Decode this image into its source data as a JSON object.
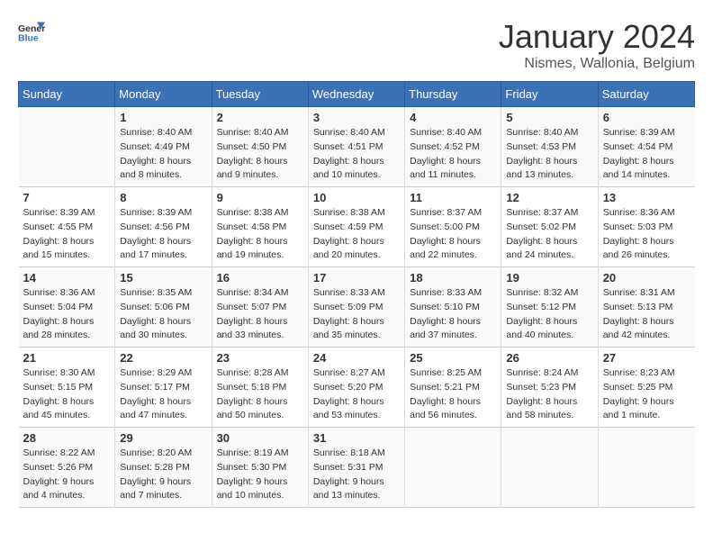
{
  "logo": {
    "line1": "General",
    "line2": "Blue"
  },
  "title": "January 2024",
  "subtitle": "Nismes, Wallonia, Belgium",
  "weekdays": [
    "Sunday",
    "Monday",
    "Tuesday",
    "Wednesday",
    "Thursday",
    "Friday",
    "Saturday"
  ],
  "weeks": [
    [
      {
        "day": "",
        "sunrise": "",
        "sunset": "",
        "daylight": ""
      },
      {
        "day": "1",
        "sunrise": "Sunrise: 8:40 AM",
        "sunset": "Sunset: 4:49 PM",
        "daylight": "Daylight: 8 hours and 8 minutes."
      },
      {
        "day": "2",
        "sunrise": "Sunrise: 8:40 AM",
        "sunset": "Sunset: 4:50 PM",
        "daylight": "Daylight: 8 hours and 9 minutes."
      },
      {
        "day": "3",
        "sunrise": "Sunrise: 8:40 AM",
        "sunset": "Sunset: 4:51 PM",
        "daylight": "Daylight: 8 hours and 10 minutes."
      },
      {
        "day": "4",
        "sunrise": "Sunrise: 8:40 AM",
        "sunset": "Sunset: 4:52 PM",
        "daylight": "Daylight: 8 hours and 11 minutes."
      },
      {
        "day": "5",
        "sunrise": "Sunrise: 8:40 AM",
        "sunset": "Sunset: 4:53 PM",
        "daylight": "Daylight: 8 hours and 13 minutes."
      },
      {
        "day": "6",
        "sunrise": "Sunrise: 8:39 AM",
        "sunset": "Sunset: 4:54 PM",
        "daylight": "Daylight: 8 hours and 14 minutes."
      }
    ],
    [
      {
        "day": "7",
        "sunrise": "Sunrise: 8:39 AM",
        "sunset": "Sunset: 4:55 PM",
        "daylight": "Daylight: 8 hours and 15 minutes."
      },
      {
        "day": "8",
        "sunrise": "Sunrise: 8:39 AM",
        "sunset": "Sunset: 4:56 PM",
        "daylight": "Daylight: 8 hours and 17 minutes."
      },
      {
        "day": "9",
        "sunrise": "Sunrise: 8:38 AM",
        "sunset": "Sunset: 4:58 PM",
        "daylight": "Daylight: 8 hours and 19 minutes."
      },
      {
        "day": "10",
        "sunrise": "Sunrise: 8:38 AM",
        "sunset": "Sunset: 4:59 PM",
        "daylight": "Daylight: 8 hours and 20 minutes."
      },
      {
        "day": "11",
        "sunrise": "Sunrise: 8:37 AM",
        "sunset": "Sunset: 5:00 PM",
        "daylight": "Daylight: 8 hours and 22 minutes."
      },
      {
        "day": "12",
        "sunrise": "Sunrise: 8:37 AM",
        "sunset": "Sunset: 5:02 PM",
        "daylight": "Daylight: 8 hours and 24 minutes."
      },
      {
        "day": "13",
        "sunrise": "Sunrise: 8:36 AM",
        "sunset": "Sunset: 5:03 PM",
        "daylight": "Daylight: 8 hours and 26 minutes."
      }
    ],
    [
      {
        "day": "14",
        "sunrise": "Sunrise: 8:36 AM",
        "sunset": "Sunset: 5:04 PM",
        "daylight": "Daylight: 8 hours and 28 minutes."
      },
      {
        "day": "15",
        "sunrise": "Sunrise: 8:35 AM",
        "sunset": "Sunset: 5:06 PM",
        "daylight": "Daylight: 8 hours and 30 minutes."
      },
      {
        "day": "16",
        "sunrise": "Sunrise: 8:34 AM",
        "sunset": "Sunset: 5:07 PM",
        "daylight": "Daylight: 8 hours and 33 minutes."
      },
      {
        "day": "17",
        "sunrise": "Sunrise: 8:33 AM",
        "sunset": "Sunset: 5:09 PM",
        "daylight": "Daylight: 8 hours and 35 minutes."
      },
      {
        "day": "18",
        "sunrise": "Sunrise: 8:33 AM",
        "sunset": "Sunset: 5:10 PM",
        "daylight": "Daylight: 8 hours and 37 minutes."
      },
      {
        "day": "19",
        "sunrise": "Sunrise: 8:32 AM",
        "sunset": "Sunset: 5:12 PM",
        "daylight": "Daylight: 8 hours and 40 minutes."
      },
      {
        "day": "20",
        "sunrise": "Sunrise: 8:31 AM",
        "sunset": "Sunset: 5:13 PM",
        "daylight": "Daylight: 8 hours and 42 minutes."
      }
    ],
    [
      {
        "day": "21",
        "sunrise": "Sunrise: 8:30 AM",
        "sunset": "Sunset: 5:15 PM",
        "daylight": "Daylight: 8 hours and 45 minutes."
      },
      {
        "day": "22",
        "sunrise": "Sunrise: 8:29 AM",
        "sunset": "Sunset: 5:17 PM",
        "daylight": "Daylight: 8 hours and 47 minutes."
      },
      {
        "day": "23",
        "sunrise": "Sunrise: 8:28 AM",
        "sunset": "Sunset: 5:18 PM",
        "daylight": "Daylight: 8 hours and 50 minutes."
      },
      {
        "day": "24",
        "sunrise": "Sunrise: 8:27 AM",
        "sunset": "Sunset: 5:20 PM",
        "daylight": "Daylight: 8 hours and 53 minutes."
      },
      {
        "day": "25",
        "sunrise": "Sunrise: 8:25 AM",
        "sunset": "Sunset: 5:21 PM",
        "daylight": "Daylight: 8 hours and 56 minutes."
      },
      {
        "day": "26",
        "sunrise": "Sunrise: 8:24 AM",
        "sunset": "Sunset: 5:23 PM",
        "daylight": "Daylight: 8 hours and 58 minutes."
      },
      {
        "day": "27",
        "sunrise": "Sunrise: 8:23 AM",
        "sunset": "Sunset: 5:25 PM",
        "daylight": "Daylight: 9 hours and 1 minute."
      }
    ],
    [
      {
        "day": "28",
        "sunrise": "Sunrise: 8:22 AM",
        "sunset": "Sunset: 5:26 PM",
        "daylight": "Daylight: 9 hours and 4 minutes."
      },
      {
        "day": "29",
        "sunrise": "Sunrise: 8:20 AM",
        "sunset": "Sunset: 5:28 PM",
        "daylight": "Daylight: 9 hours and 7 minutes."
      },
      {
        "day": "30",
        "sunrise": "Sunrise: 8:19 AM",
        "sunset": "Sunset: 5:30 PM",
        "daylight": "Daylight: 9 hours and 10 minutes."
      },
      {
        "day": "31",
        "sunrise": "Sunrise: 8:18 AM",
        "sunset": "Sunset: 5:31 PM",
        "daylight": "Daylight: 9 hours and 13 minutes."
      },
      {
        "day": "",
        "sunrise": "",
        "sunset": "",
        "daylight": ""
      },
      {
        "day": "",
        "sunrise": "",
        "sunset": "",
        "daylight": ""
      },
      {
        "day": "",
        "sunrise": "",
        "sunset": "",
        "daylight": ""
      }
    ]
  ]
}
